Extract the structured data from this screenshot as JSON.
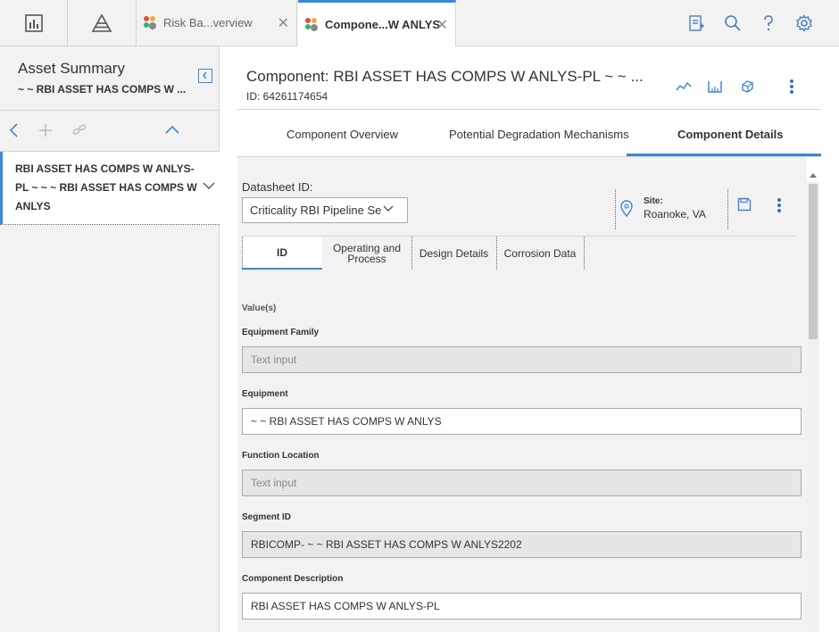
{
  "tabs": [
    {
      "label": "Risk Ba...verview",
      "close": "✕"
    },
    {
      "label": "Compone...W ANLYS",
      "close": "✕"
    }
  ],
  "left_panel": {
    "title": "Asset Summary",
    "subtitle": "~ ~ RBI ASSET HAS COMPS W ...",
    "selected_item": "RBI ASSET HAS COMPS W ANLYS-PL ~ ~ ~ RBI ASSET HAS COMPS W ANLYS"
  },
  "component": {
    "title": "Component: RBI ASSET HAS COMPS W ANLYS-PL ~ ~ ...",
    "id_text": "ID: 64261174654"
  },
  "subtabs": [
    {
      "label": "Component Overview"
    },
    {
      "label": "Potential Degradation Mechanisms"
    },
    {
      "label": "Component Details"
    }
  ],
  "datasheet": {
    "label": "Datasheet ID:",
    "selected": "Criticality RBI Pipeline Se",
    "site_label": "Site:",
    "site_value": "Roanoke, VA"
  },
  "field_tabs": [
    {
      "label": "ID"
    },
    {
      "label": "Operating and Process"
    },
    {
      "label": "Design Details"
    },
    {
      "label": "Corrosion Data"
    }
  ],
  "section_label": "Value(s)",
  "fields": [
    {
      "label": "Equipment Family",
      "value": "Text input"
    },
    {
      "label": "Equipment",
      "value": "~ ~ RBI ASSET HAS COMPS W ANLYS"
    },
    {
      "label": "Function Location",
      "value": "Text input"
    },
    {
      "label": "Segment ID",
      "value": "RBICOMP- ~ ~ RBI ASSET HAS COMPS W ANLYS2202"
    },
    {
      "label": "Component Description",
      "value": "RBI ASSET HAS COMPS W ANLYS-PL"
    }
  ],
  "colors": {
    "accent": "#3d87d6",
    "panel": "#f2f2f2"
  }
}
